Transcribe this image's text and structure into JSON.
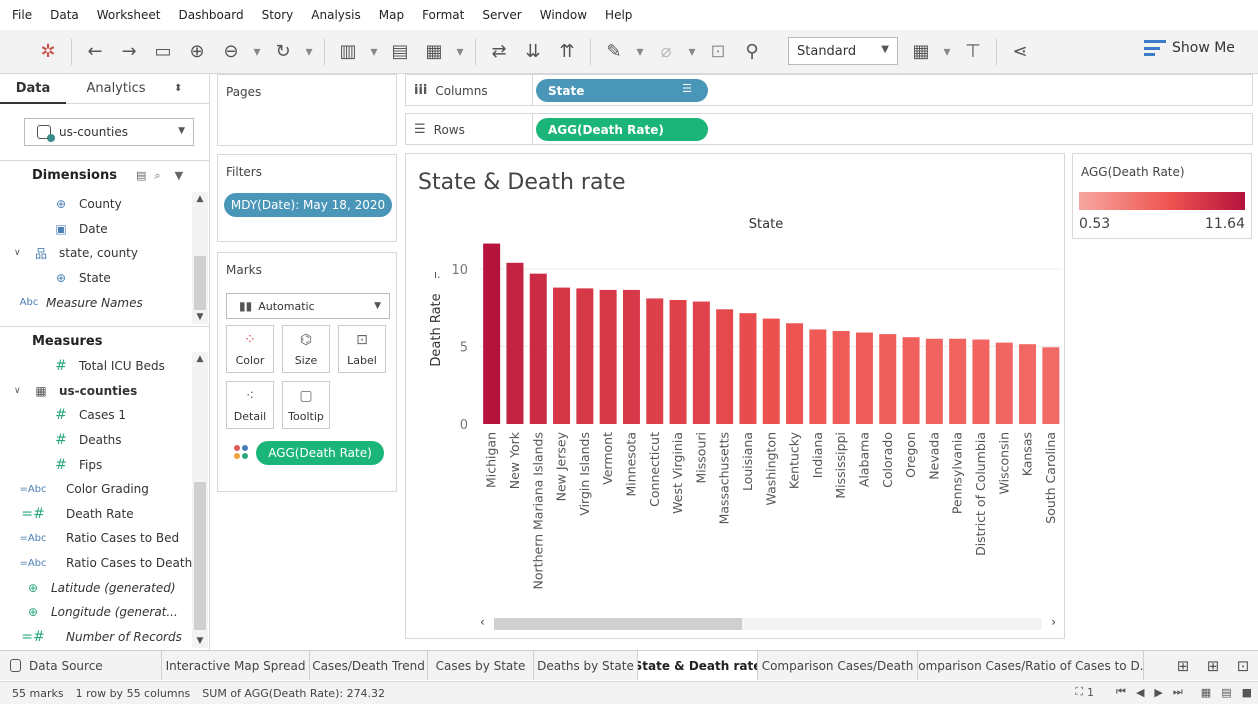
{
  "menu": [
    "File",
    "Data",
    "Worksheet",
    "Dashboard",
    "Story",
    "Analysis",
    "Map",
    "Format",
    "Server",
    "Window",
    "Help"
  ],
  "toolbar": {
    "fit_select": "Standard",
    "show_me": "Show Me"
  },
  "left_panel": {
    "tabs": {
      "data": "Data",
      "analytics": "Analytics"
    },
    "datasource": "us-counties",
    "dimensions_title": "Dimensions",
    "dimensions": [
      {
        "label": "County",
        "icon": "globe-icon"
      },
      {
        "label": "Date",
        "icon": "calendar-icon"
      },
      {
        "label": "state, county",
        "icon": "hierarchy-icon"
      },
      {
        "label": "State",
        "icon": "globe-icon"
      },
      {
        "label": "Measure Names",
        "icon": "abc-icon"
      }
    ],
    "measures_title": "Measures",
    "measures": [
      {
        "label": "Total ICU Beds",
        "icon": "hash-icon"
      },
      {
        "label": "us-counties",
        "icon": "table-icon"
      },
      {
        "label": "Cases 1",
        "icon": "hash-icon"
      },
      {
        "label": "Deaths",
        "icon": "hash-icon"
      },
      {
        "label": "Fips",
        "icon": "hash-icon"
      },
      {
        "label": "Color Grading",
        "icon": "calc-abc-icon"
      },
      {
        "label": "Death Rate",
        "icon": "calc-hash-icon"
      },
      {
        "label": "Ratio Cases to Bed",
        "icon": "calc-abc-icon"
      },
      {
        "label": "Ratio Cases to Death",
        "icon": "calc-abc-icon"
      },
      {
        "label": "Latitude (generated)",
        "icon": "globe-icon"
      },
      {
        "label": "Longitude (generat...",
        "icon": "globe-icon"
      },
      {
        "label": "Number of Records",
        "icon": "calc-hash-icon"
      }
    ]
  },
  "cards": {
    "pages": "Pages",
    "filters": "Filters",
    "filter_pill": "MDY(Date): May 18, 2020",
    "marks": "Marks",
    "mark_type": "Automatic",
    "mark_buttons": {
      "color": "Color",
      "size": "Size",
      "label": "Label",
      "detail": "Detail",
      "tooltip": "Tooltip"
    },
    "mark_pill": "AGG(Death Rate)"
  },
  "shelves": {
    "columns_label": "Columns",
    "columns_pill": "State",
    "rows_label": "Rows",
    "rows_pill": "AGG(Death Rate)"
  },
  "chart_title": "State & Death rate",
  "chart_data": {
    "type": "bar",
    "title": "State & Death rate",
    "xlabel": "State",
    "ylabel": "Death Rate",
    "ylim": [
      0,
      12
    ],
    "yticks": [
      0,
      5,
      10
    ],
    "grid": true,
    "categories": [
      "Michigan",
      "New York",
      "Northern Mariana Islands",
      "New Jersey",
      "Virgin Islands",
      "Vermont",
      "Minnesota",
      "Connecticut",
      "West Virginia",
      "Missouri",
      "Massachusetts",
      "Louisiana",
      "Washington",
      "Kentucky",
      "Indiana",
      "Mississippi",
      "Alabama",
      "Colorado",
      "Oregon",
      "Nevada",
      "Pennsylvania",
      "District of Columbia",
      "Wisconsin",
      "Kansas",
      "South Carolina"
    ],
    "values": [
      11.64,
      10.4,
      9.7,
      8.8,
      8.75,
      8.65,
      8.65,
      8.1,
      8.0,
      7.9,
      7.4,
      7.15,
      6.8,
      6.5,
      6.1,
      6.0,
      5.9,
      5.8,
      5.6,
      5.5,
      5.5,
      5.45,
      5.25,
      5.15,
      4.95
    ],
    "color_range": [
      0.53,
      11.64
    ],
    "color_low": "#f7a7a0",
    "color_mid": "#ee5350",
    "color_high": "#b5123c"
  },
  "legend": {
    "title": "AGG(Death Rate)",
    "min": "0.53",
    "max": "11.64"
  },
  "sheet_tabs": {
    "datasource": "Data Source",
    "tabs": [
      "Interactive Map Spread",
      "Cases/Death Trend",
      "Cases by State",
      "Deaths by State",
      "State & Death rate",
      "Comparison Cases/Death",
      "Comparison Cases/Ratio of Cases to D..."
    ],
    "active": "State & Death rate"
  },
  "status": {
    "marks": "55 marks",
    "dims": "1 row by 55 columns",
    "sum": "SUM of AGG(Death Rate): 274.32",
    "page": "1"
  }
}
